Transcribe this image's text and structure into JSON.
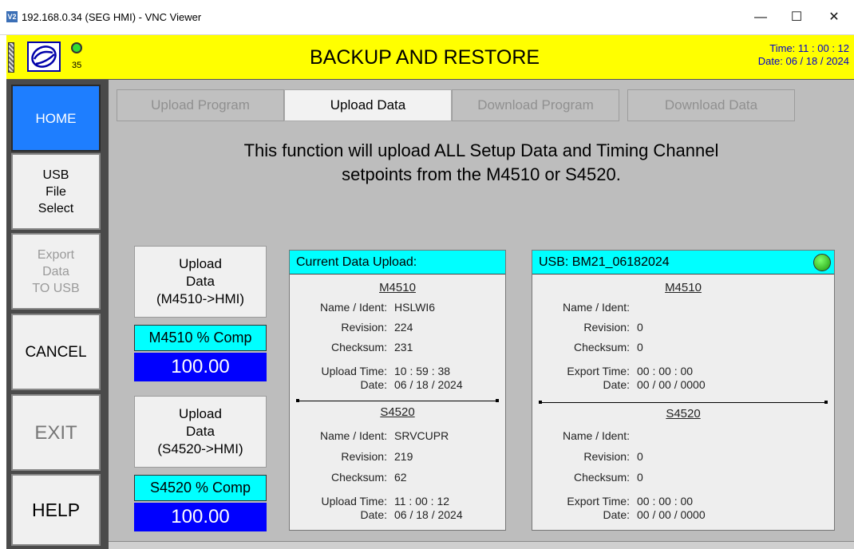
{
  "window": {
    "title": "192.168.0.34 (SEG HMI) - VNC Viewer",
    "app_icon": "V2",
    "minimize": "—",
    "maximize": "☐",
    "close": "✕"
  },
  "header": {
    "title": "BACKUP AND RESTORE",
    "counter": "35",
    "time": "Time: 11 : 00 : 12",
    "date": "Date: 06 / 18 / 2024"
  },
  "sidebar": {
    "home": "HOME",
    "usb_file_select": "USB\nFile\nSelect",
    "export_data": "Export\nData\nTO USB",
    "cancel": "CANCEL",
    "exit": "EXIT",
    "help": "HELP"
  },
  "tabs": [
    {
      "label": "Upload Program",
      "active": false
    },
    {
      "label": "Upload Data",
      "active": true
    },
    {
      "label": "Download Program",
      "active": false
    },
    {
      "label": "Download Data",
      "active": false
    }
  ],
  "description": {
    "line1": "This function will upload ALL Setup Data and Timing Channel",
    "line2": "setpoints from the M4510 or S4520."
  },
  "upload_m4510": {
    "button": "Upload\nData\n(M4510->HMI)",
    "comp_label": "M4510 % Comp",
    "comp_value": "100.00"
  },
  "upload_s4520": {
    "button": "Upload\nData\n(S4520->HMI)",
    "comp_label": "S4520 % Comp",
    "comp_value": "100.00"
  },
  "current": {
    "header": "Current Data Upload:",
    "m4510": {
      "section": "M4510",
      "name_label": "Name / Ident:",
      "name": "HSLWI6",
      "revision_label": "Revision:",
      "revision": "224",
      "checksum_label": "Checksum:",
      "checksum": "231",
      "time_label": "Upload Time:",
      "time": "10 : 59 : 38",
      "date_label": "Date:",
      "date": "06 / 18 / 2024"
    },
    "s4520": {
      "section": "S4520",
      "name_label": "Name / Ident:",
      "name": "SRVCUPR",
      "revision_label": "Revision:",
      "revision": "219",
      "checksum_label": "Checksum:",
      "checksum": "62",
      "time_label": "Upload Time:",
      "time": "11 : 00 : 12",
      "date_label": "Date:",
      "date": "06 / 18 / 2024"
    }
  },
  "usb": {
    "header": "USB: BM21_06182024",
    "status_color": "#33cc22",
    "m4510": {
      "section": "M4510",
      "name_label": "Name / Ident:",
      "name": "",
      "revision_label": "Revision:",
      "revision": "0",
      "checksum_label": "Checksum:",
      "checksum": "0",
      "time_label": "Export Time:",
      "time": "00 : 00 : 00",
      "date_label": "Date:",
      "date": "00 / 00 / 0000"
    },
    "s4520": {
      "section": "S4520",
      "name_label": "Name / Ident:",
      "name": "",
      "revision_label": "Revision:",
      "revision": "0",
      "checksum_label": "Checksum:",
      "checksum": "0",
      "time_label": "Export Time:",
      "time": "00 : 00 : 00",
      "date_label": "Date:",
      "date": "00 / 00 / 0000"
    }
  }
}
